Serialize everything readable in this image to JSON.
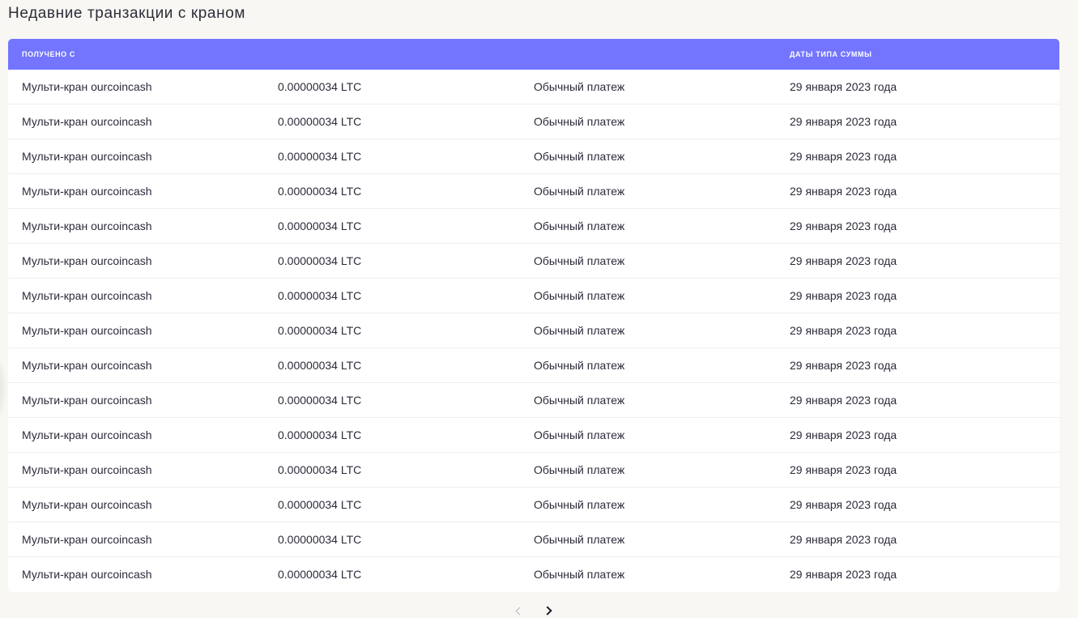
{
  "page": {
    "title": "Недавние транзакции с краном"
  },
  "table": {
    "header": {
      "received_from": "ПОЛУЧЕНО С",
      "dates_type_amount": "ДАТЫ ТИПА СУММЫ"
    },
    "rows": [
      {
        "source": "Мульти-кран ourcoincash",
        "amount": "0.00000034 LTC",
        "type": "Обычный платеж",
        "date": "29 января 2023 года"
      },
      {
        "source": "Мульти-кран ourcoincash",
        "amount": "0.00000034 LTC",
        "type": "Обычный платеж",
        "date": "29 января 2023 года"
      },
      {
        "source": "Мульти-кран ourcoincash",
        "amount": "0.00000034 LTC",
        "type": "Обычный платеж",
        "date": "29 января 2023 года"
      },
      {
        "source": "Мульти-кран ourcoincash",
        "amount": "0.00000034 LTC",
        "type": "Обычный платеж",
        "date": "29 января 2023 года"
      },
      {
        "source": "Мульти-кран ourcoincash",
        "amount": "0.00000034 LTC",
        "type": "Обычный платеж",
        "date": "29 января 2023 года"
      },
      {
        "source": "Мульти-кран ourcoincash",
        "amount": "0.00000034 LTC",
        "type": "Обычный платеж",
        "date": "29 января 2023 года"
      },
      {
        "source": "Мульти-кран ourcoincash",
        "amount": "0.00000034 LTC",
        "type": "Обычный платеж",
        "date": "29 января 2023 года"
      },
      {
        "source": "Мульти-кран ourcoincash",
        "amount": "0.00000034 LTC",
        "type": "Обычный платеж",
        "date": "29 января 2023 года"
      },
      {
        "source": "Мульти-кран ourcoincash",
        "amount": "0.00000034 LTC",
        "type": "Обычный платеж",
        "date": "29 января 2023 года"
      },
      {
        "source": "Мульти-кран ourcoincash",
        "amount": "0.00000034 LTC",
        "type": "Обычный платеж",
        "date": "29 января 2023 года"
      },
      {
        "source": "Мульти-кран ourcoincash",
        "amount": "0.00000034 LTC",
        "type": "Обычный платеж",
        "date": "29 января 2023 года"
      },
      {
        "source": "Мульти-кран ourcoincash",
        "amount": "0.00000034 LTC",
        "type": "Обычный платеж",
        "date": "29 января 2023 года"
      },
      {
        "source": "Мульти-кран ourcoincash",
        "amount": "0.00000034 LTC",
        "type": "Обычный платеж",
        "date": "29 января 2023 года"
      },
      {
        "source": "Мульти-кран ourcoincash",
        "amount": "0.00000034 LTC",
        "type": "Обычный платеж",
        "date": "29 января 2023 года"
      },
      {
        "source": "Мульти-кран ourcoincash",
        "amount": "0.00000034 LTC",
        "type": "Обычный платеж",
        "date": "29 января 2023 года"
      }
    ]
  },
  "pagination": {
    "prev_icon": "chevron-left-icon",
    "next_icon": "chevron-right-icon",
    "prev_enabled": false,
    "next_enabled": true
  },
  "colors": {
    "header_bg": "#7375ff",
    "page_bg": "#f8f7f3",
    "card_bg": "#ffffff",
    "text": "#2b2b3a"
  }
}
